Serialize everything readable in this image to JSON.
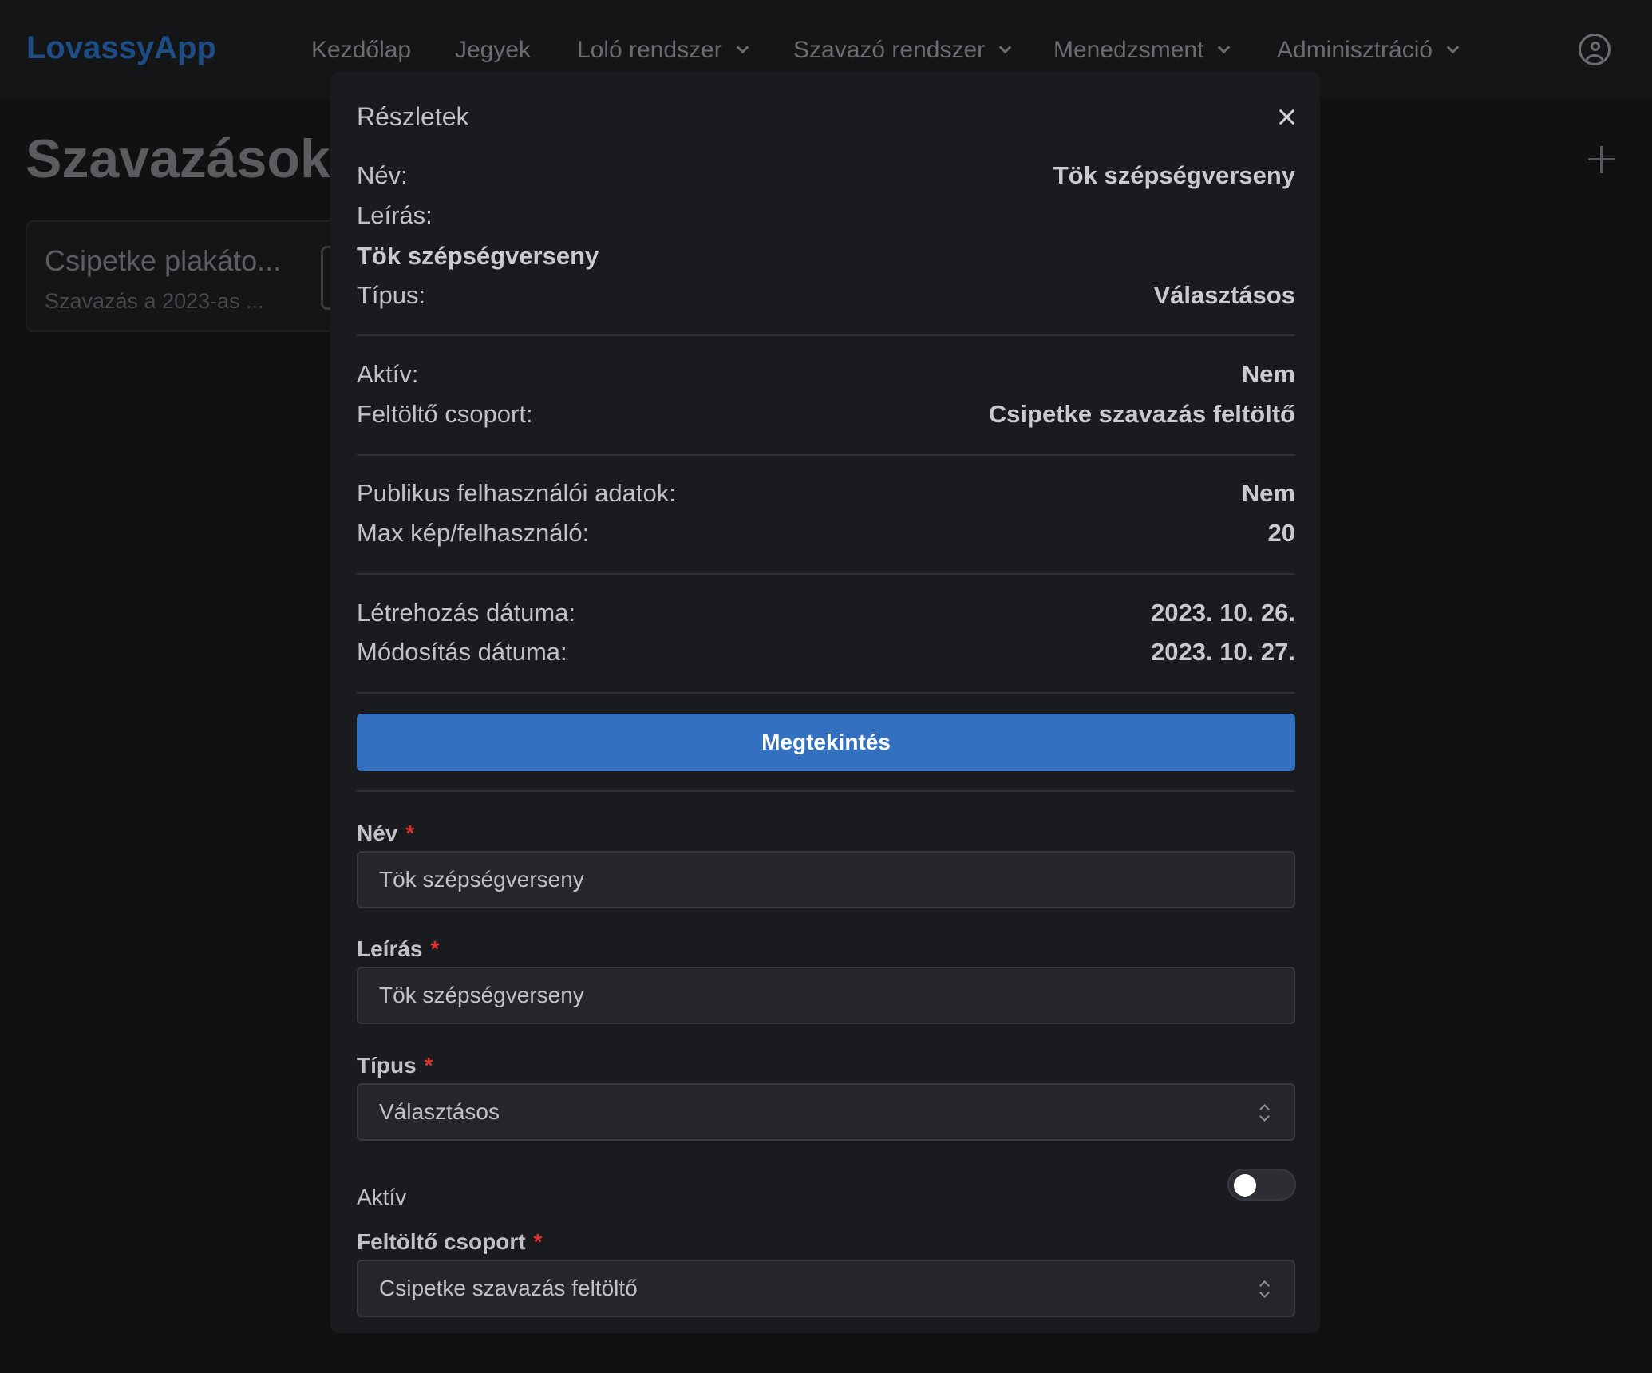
{
  "app": {
    "logo": "LovassyApp",
    "nav": [
      {
        "label": "Kezdőlap",
        "dropdown": false
      },
      {
        "label": "Jegyek",
        "dropdown": false
      },
      {
        "label": "Loló rendszer",
        "dropdown": true
      },
      {
        "label": "Szavazó rendszer",
        "dropdown": true
      },
      {
        "label": "Menedzsment",
        "dropdown": true
      },
      {
        "label": "Adminisztráció",
        "dropdown": true
      }
    ],
    "user_icon": "user-circle-icon"
  },
  "page": {
    "title": "Szavazások",
    "add_icon": "plus-icon",
    "cards": [
      {
        "title": "Csipetke plakáto...",
        "subtitle": "Szavazás a 2023-as ..."
      }
    ]
  },
  "modal": {
    "title": "Részletek",
    "close_icon": "close-icon",
    "details": {
      "name_label": "Név:",
      "name_value": "Tök szépségverseny",
      "description_label": "Leírás:",
      "description_value": "Tök szépségverseny",
      "type_label": "Típus:",
      "type_value": "Választásos",
      "active_label": "Aktív:",
      "active_value": "Nem",
      "uploader_group_label": "Feltöltő csoport:",
      "uploader_group_value": "Csipetke szavazás feltöltő",
      "public_user_data_label": "Publikus felhasználói adatok:",
      "public_user_data_value": "Nem",
      "max_images_label": "Max kép/felhasználó:",
      "max_images_value": "20",
      "created_label": "Létrehozás dátuma:",
      "created_value": "2023. 10. 26.",
      "modified_label": "Módosítás dátuma:",
      "modified_value": "2023. 10. 27."
    },
    "view_button": "Megtekintés",
    "form": {
      "name_label": "Név",
      "name_value": "Tök szépségverseny",
      "description_label": "Leírás",
      "description_value": "Tök szépségverseny",
      "type_label": "Típus",
      "type_value": "Választásos",
      "active_label": "Aktív",
      "active_checked": false,
      "uploader_group_label": "Feltöltő csoport",
      "uploader_group_value": "Csipetke szavazás feltöltő",
      "required_mark": "*"
    }
  },
  "colors": {
    "accent": "#3470c0",
    "logo": "#1e4d86",
    "required": "#e03131",
    "modal_bg": "#1a1b1e"
  }
}
